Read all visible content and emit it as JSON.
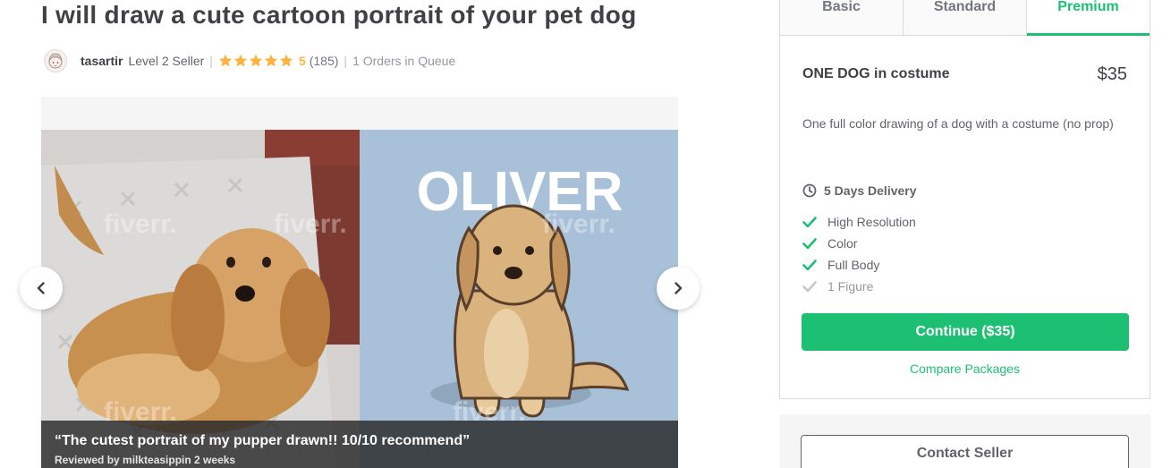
{
  "gig": {
    "title": "I will draw a cute cartoon portrait of your pet dog"
  },
  "seller": {
    "avatar_icon": "cartoon-avatar-icon",
    "name": "tasartir",
    "level": "Level 2 Seller",
    "separator": "|",
    "rating_stars": 5,
    "rating": "5",
    "rating_count": "(185)",
    "queue": "1 Orders in Queue"
  },
  "gallery": {
    "watermark": "fiverr.",
    "name_text": "OLIVER",
    "review_quote": "“The cutest portrait of my pupper drawn!! 10/10 recommend”",
    "review_by": "Reviewed by milkteasippin 2 weeks",
    "prev_icon": "chevron-left-icon",
    "next_icon": "chevron-right-icon"
  },
  "packages": {
    "tabs": [
      {
        "label": "Basic"
      },
      {
        "label": "Standard"
      },
      {
        "label": "Premium"
      }
    ],
    "active_tab": "Premium",
    "name": "ONE DOG in costume",
    "price": "$35",
    "description": "One full color drawing of a dog with a costume (no prop)",
    "delivery": "5 Days Delivery",
    "features": [
      {
        "label": "High Resolution",
        "included": true
      },
      {
        "label": "Color",
        "included": true
      },
      {
        "label": "Full Body",
        "included": true
      },
      {
        "label": "1 Figure",
        "included": false
      }
    ],
    "continue_label": "Continue ($35)",
    "compare_label": "Compare Packages"
  },
  "contact": {
    "label": "Contact Seller"
  },
  "colors": {
    "brand_green": "#1dbf73",
    "star": "#ffb33e",
    "text": "#404145"
  }
}
